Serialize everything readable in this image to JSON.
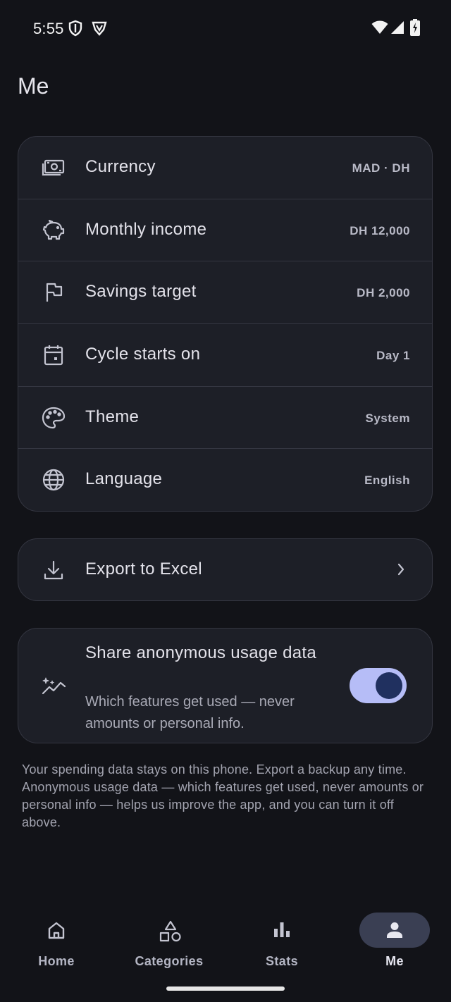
{
  "status_bar": {
    "time": "5:55"
  },
  "page": {
    "title": "Me"
  },
  "settings": [
    {
      "key": "currency",
      "icon": "money-icon",
      "label": "Currency",
      "value": "MAD · DH"
    },
    {
      "key": "income",
      "icon": "piggy-bank-icon",
      "label": "Monthly income",
      "value": "DH 12,000"
    },
    {
      "key": "savings",
      "icon": "flag-icon",
      "label": "Savings target",
      "value": "DH 2,000"
    },
    {
      "key": "cycle",
      "icon": "calendar-icon",
      "label": "Cycle starts on",
      "value": "Day 1"
    },
    {
      "key": "theme",
      "icon": "palette-icon",
      "label": "Theme",
      "value": "System"
    },
    {
      "key": "language",
      "icon": "globe-icon",
      "label": "Language",
      "value": "English"
    }
  ],
  "export": {
    "icon": "download-icon",
    "label": "Export to Excel"
  },
  "usage": {
    "icon": "sparkle-chart-icon",
    "title": "Share anonymous usage data",
    "description": "Which features get used — never amounts or personal info.",
    "enabled": true
  },
  "footnote": "Your spending data stays on this phone. Export a backup any time. Anonymous usage data — which features get used, never amounts or personal info — helps us improve the app, and you can turn it off above.",
  "nav": [
    {
      "key": "home",
      "label": "Home",
      "icon": "home-icon",
      "active": false
    },
    {
      "key": "categories",
      "label": "Categories",
      "icon": "shapes-icon",
      "active": false
    },
    {
      "key": "stats",
      "label": "Stats",
      "icon": "bar-chart-icon",
      "active": false
    },
    {
      "key": "me",
      "label": "Me",
      "icon": "person-icon",
      "active": true
    }
  ],
  "colors": {
    "background": "#121318",
    "card": "#1d1f27",
    "toggle_track": "#b6bdf7",
    "toggle_knob": "#20305f",
    "nav_active_pill": "#3a3f53"
  }
}
